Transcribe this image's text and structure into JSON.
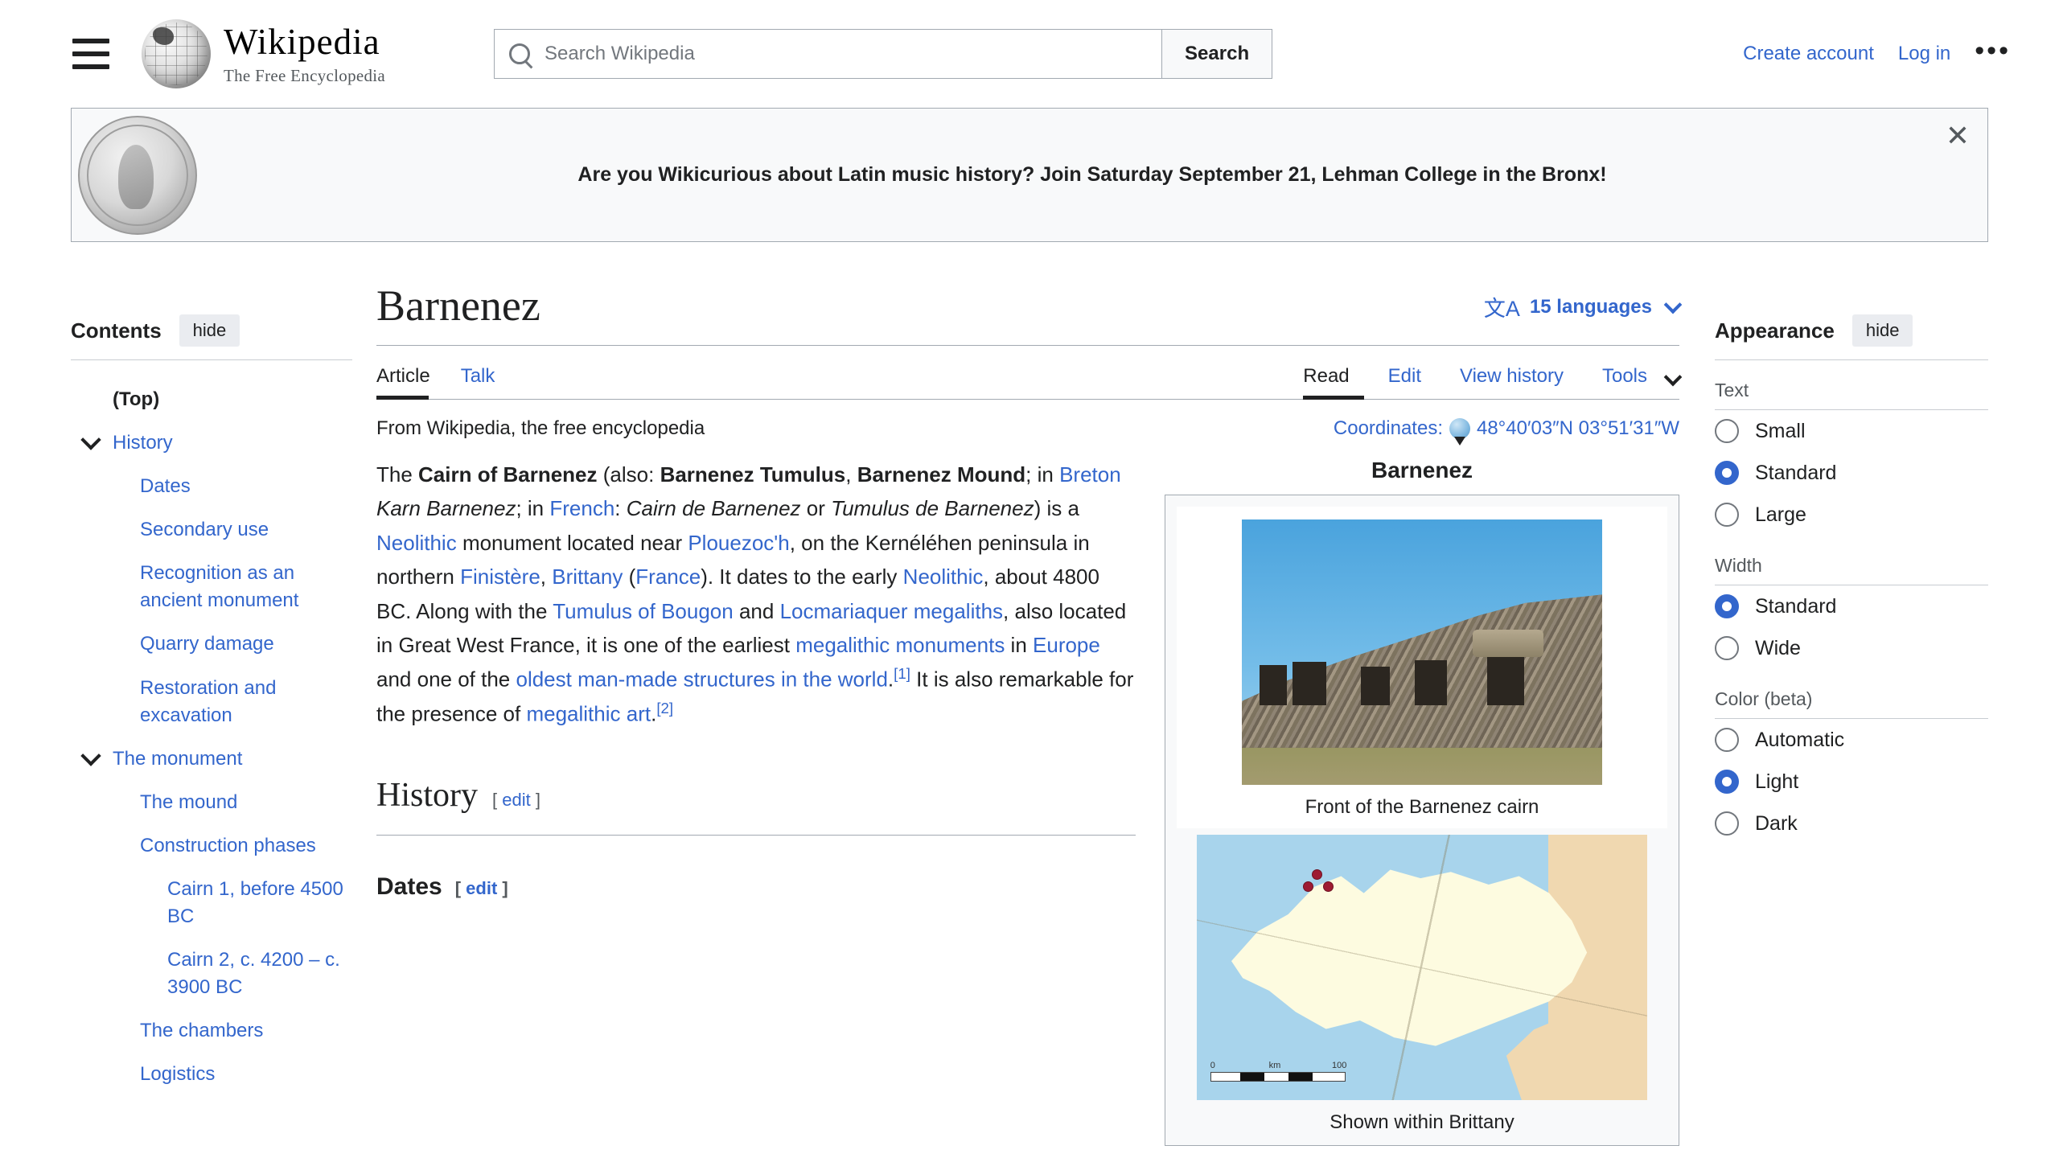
{
  "header": {
    "menu_icon": "hamburger-icon",
    "logo_name": "Wikipedia",
    "logo_tagline": "The Free Encyclopedia",
    "search_placeholder": "Search Wikipedia",
    "search_value": "",
    "search_button": "Search",
    "create_account": "Create account",
    "log_in": "Log in",
    "more_menu": "•••"
  },
  "banner": {
    "text": "Are you Wikicurious about Latin music history? Join Saturday September 21, Lehman College in the Bronx!",
    "close": "✕"
  },
  "toc": {
    "title": "Contents",
    "hide_label": "hide",
    "items": [
      {
        "label": "(Top)",
        "level": "top",
        "expandable": false
      },
      {
        "label": "History",
        "level": "lvl1",
        "expandable": true
      },
      {
        "label": "Dates",
        "level": "lvl2",
        "expandable": false
      },
      {
        "label": "Secondary use",
        "level": "lvl2",
        "expandable": false
      },
      {
        "label": "Recognition as an ancient monument",
        "level": "lvl2",
        "expandable": false
      },
      {
        "label": "Quarry damage",
        "level": "lvl2",
        "expandable": false
      },
      {
        "label": "Restoration and excavation",
        "level": "lvl2",
        "expandable": false
      },
      {
        "label": "The monument",
        "level": "lvl1",
        "expandable": true
      },
      {
        "label": "The mound",
        "level": "lvl2",
        "expandable": false
      },
      {
        "label": "Construction phases",
        "level": "lvl2",
        "expandable": false
      },
      {
        "label": "Cairn 1, before 4500 BC",
        "level": "lvl3",
        "expandable": false
      },
      {
        "label": "Cairn 2, c. 4200 – c. 3900 BC",
        "level": "lvl3",
        "expandable": false
      },
      {
        "label": "The chambers",
        "level": "lvl2",
        "expandable": false
      },
      {
        "label": "Logistics",
        "level": "lvl2",
        "expandable": false
      }
    ]
  },
  "article": {
    "title": "Barnenez",
    "languages_label": "15 languages",
    "language_icon": "文A",
    "tabs_left": [
      {
        "label": "Article",
        "active": true
      },
      {
        "label": "Talk",
        "active": false
      }
    ],
    "tabs_right": [
      {
        "label": "Read",
        "active": true
      },
      {
        "label": "Edit",
        "active": false
      },
      {
        "label": "View history",
        "active": false
      },
      {
        "label": "Tools",
        "active": false
      }
    ],
    "site_sub": "From Wikipedia, the free encyclopedia",
    "coordinates_label": "Coordinates:",
    "coordinates_value": "48°40′03″N 03°51′31″W",
    "lead": {
      "s1": "The ",
      "b1": "Cairn of Barnenez",
      "s2": " (also: ",
      "b2": "Barnenez Tumulus",
      "s3": ", ",
      "b3": "Barnenez Mound",
      "s4": "; in ",
      "l_breton": "Breton",
      "s5": " ",
      "i1": "Karn Barnenez",
      "s6": "; in ",
      "l_french": "French",
      "s7": ": ",
      "i2": "Cairn de Barnenez",
      "s8": " or ",
      "i3": "Tumulus de Barnenez",
      "s9": ") is a ",
      "l_neo1": "Neolithic",
      "s10": " monument located near ",
      "l_plouezoch": "Plouezoc'h",
      "s11": ", on the Kernéléhen peninsula in northern ",
      "l_finistere": "Finistère",
      "s12": ", ",
      "l_brittany": "Brittany",
      "s13": " (",
      "l_france": "France",
      "s14": "). It dates to the early ",
      "l_neo2": "Neolithic",
      "s15": ", about 4800 BC. Along with the ",
      "l_bougon": "Tumulus of Bougon",
      "s16": " and ",
      "l_locmariaquer": "Locmariaquer megaliths",
      "s17": ", also located in Great West France, it is one of the earliest ",
      "l_megmon": "megalithic monuments",
      "s18": " in ",
      "l_europe": "Europe",
      "s19": " and one of the ",
      "l_oldest": "oldest man-made structures in the world",
      "s20": ".",
      "ref1": "[1]",
      "s21": " It is also remarkable for the presence of ",
      "l_megart": "megalithic art",
      "s22": ".",
      "ref2": "[2]"
    },
    "sections": [
      {
        "heading": "History",
        "edit": "edit",
        "level": "h2"
      },
      {
        "heading": "Dates",
        "edit": "edit",
        "level": "h3"
      }
    ],
    "edit_bracket_open": "[",
    "edit_bracket_close": "]"
  },
  "infobox": {
    "title": "Barnenez",
    "photo_name": "barnenez-cairn-photo",
    "photo_caption": "Front of the Barnenez cairn",
    "map_name": "brittany-location-map",
    "map_caption": "Shown within Brittany",
    "map_scale_labels": [
      "0",
      "km",
      "100"
    ]
  },
  "appearance": {
    "title": "Appearance",
    "hide_label": "hide",
    "groups": [
      {
        "label": "Text",
        "options": [
          {
            "label": "Small",
            "selected": false
          },
          {
            "label": "Standard",
            "selected": true
          },
          {
            "label": "Large",
            "selected": false
          }
        ]
      },
      {
        "label": "Width",
        "options": [
          {
            "label": "Standard",
            "selected": true
          },
          {
            "label": "Wide",
            "selected": false
          }
        ]
      },
      {
        "label": "Color (beta)",
        "options": [
          {
            "label": "Automatic",
            "selected": false
          },
          {
            "label": "Light",
            "selected": true
          },
          {
            "label": "Dark",
            "selected": false
          }
        ]
      }
    ]
  },
  "colors": {
    "link": "#3366cc",
    "text": "#202122",
    "accent": "#3366cc",
    "panel_bg": "#f8f9fa",
    "border": "#a2a9b1"
  }
}
